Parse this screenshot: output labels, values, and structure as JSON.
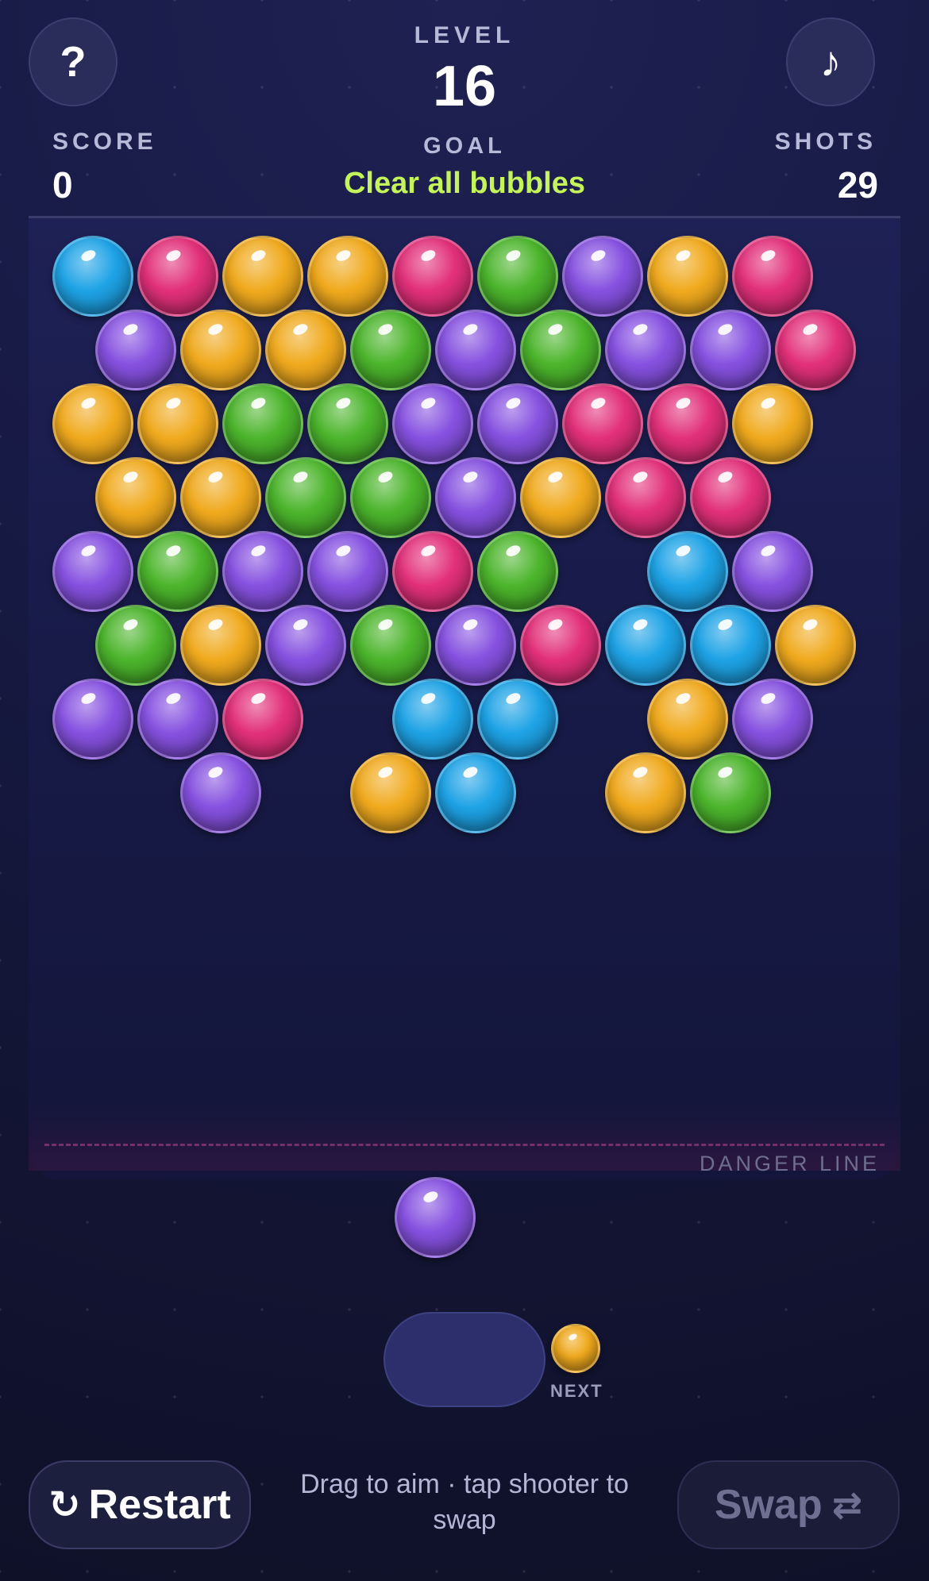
{
  "header": {
    "help_symbol": "?",
    "music_symbol": "♪",
    "level_label": "LEVEL",
    "level_value": "16",
    "score_label": "SCORE",
    "score_value": "0",
    "goal_label": "GOAL",
    "goal_text": "Clear all bubbles",
    "shots_label": "SHOTS",
    "shots_value": "29"
  },
  "board": {
    "danger_label": "DANGER LINE",
    "rows": [
      [
        "blue",
        "pink",
        "yellow",
        "yellow",
        "pink",
        "green",
        "purple",
        "yellow",
        "pink"
      ],
      [
        "purple",
        "yellow",
        "yellow",
        "green",
        "purple",
        "green",
        "purple",
        "purple",
        "pink"
      ],
      [
        "yellow",
        "yellow",
        "green",
        "green",
        "purple",
        "purple",
        "pink",
        "pink",
        "yellow"
      ],
      [
        "yellow",
        "yellow",
        "green",
        "green",
        "purple",
        "yellow",
        "pink",
        "pink"
      ],
      [
        "purple",
        "green",
        "purple",
        "purple",
        "pink",
        "green",
        "",
        "blue",
        "purple"
      ],
      [
        "green",
        "yellow",
        "purple",
        "green",
        "purple",
        "pink",
        "blue",
        "blue",
        "yellow"
      ],
      [
        "purple",
        "purple",
        "pink",
        "",
        "blue",
        "blue",
        "",
        "yellow",
        "purple"
      ],
      [
        "",
        "purple",
        "",
        "yellow",
        "blue",
        "",
        "yellow",
        "green"
      ]
    ]
  },
  "shooter": {
    "current": "purple",
    "next": "yellow",
    "next_label": "NEXT"
  },
  "footer": {
    "restart_label": "Restart",
    "restart_icon": "↻",
    "hint": "Drag to aim · tap shooter to swap",
    "swap_label": "Swap",
    "swap_icon": "⇄"
  },
  "colors": {
    "goal": "#c4f45a",
    "blue": "#1ea3e6",
    "pink": "#e2307a",
    "yellow": "#f0aa1e",
    "green": "#4cb52c",
    "purple": "#8651e0"
  }
}
